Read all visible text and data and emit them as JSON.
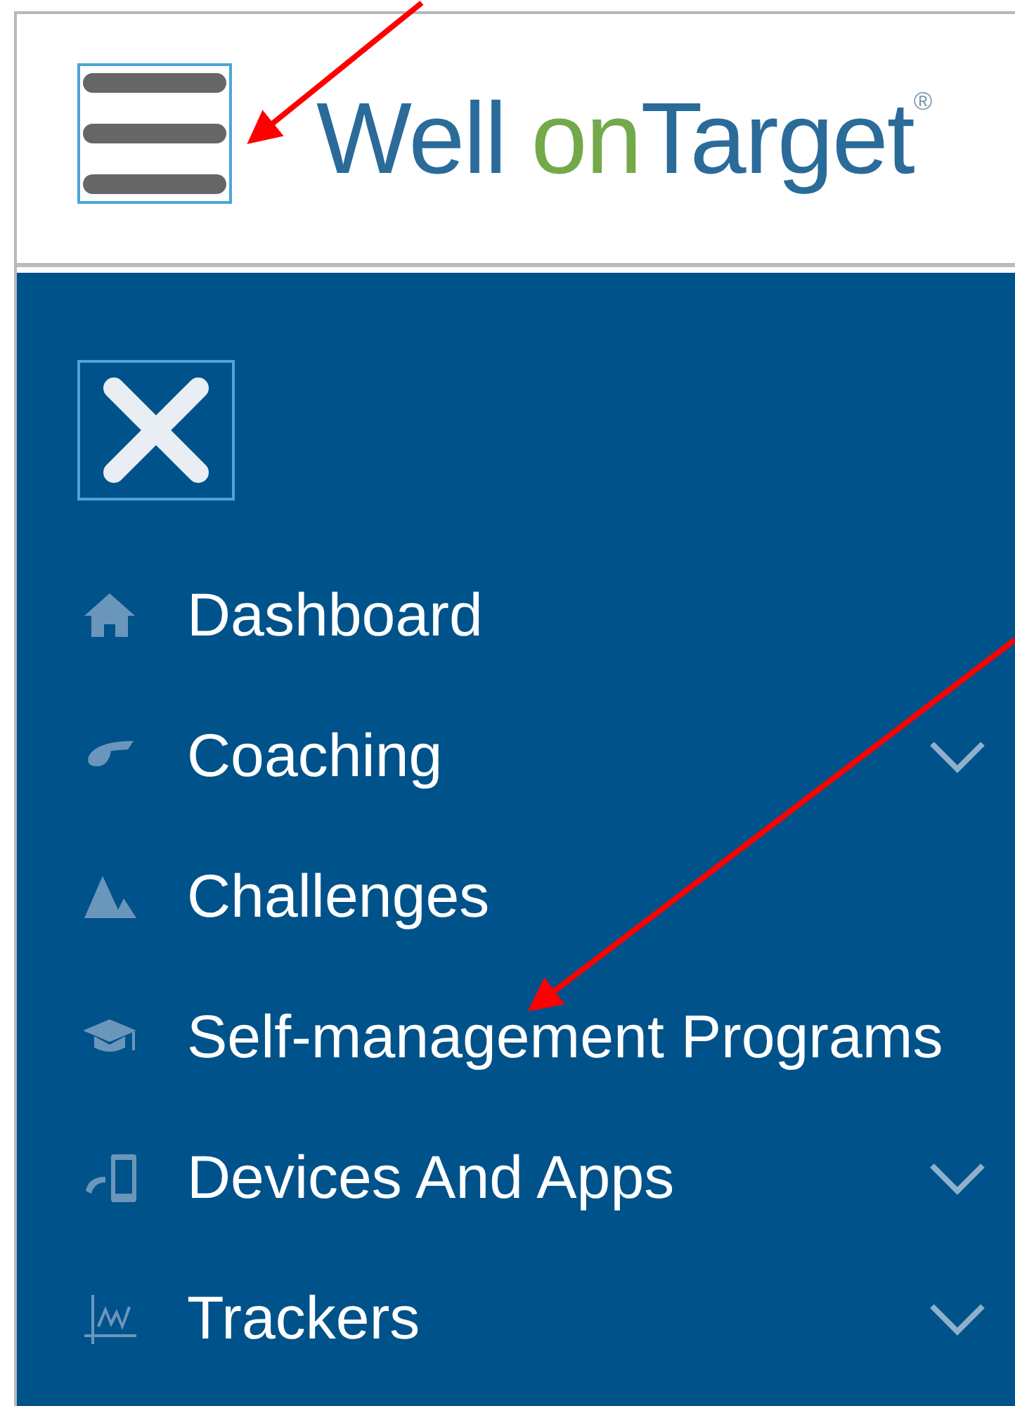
{
  "header": {
    "logo": {
      "part_1": "Well",
      "part_2": "on",
      "part_3": "Target",
      "mark": "®"
    }
  },
  "nav": {
    "items": [
      {
        "label": "Dashboard",
        "kind": "home",
        "expandable": false
      },
      {
        "label": "Coaching",
        "kind": "whistle",
        "expandable": true
      },
      {
        "label": "Challenges",
        "kind": "mountains",
        "expandable": false
      },
      {
        "label": "Self-management Programs",
        "kind": "cap",
        "expandable": false
      },
      {
        "label": "Devices And Apps",
        "kind": "devices",
        "expandable": true
      },
      {
        "label": "Trackers",
        "kind": "chart",
        "expandable": true
      }
    ]
  }
}
